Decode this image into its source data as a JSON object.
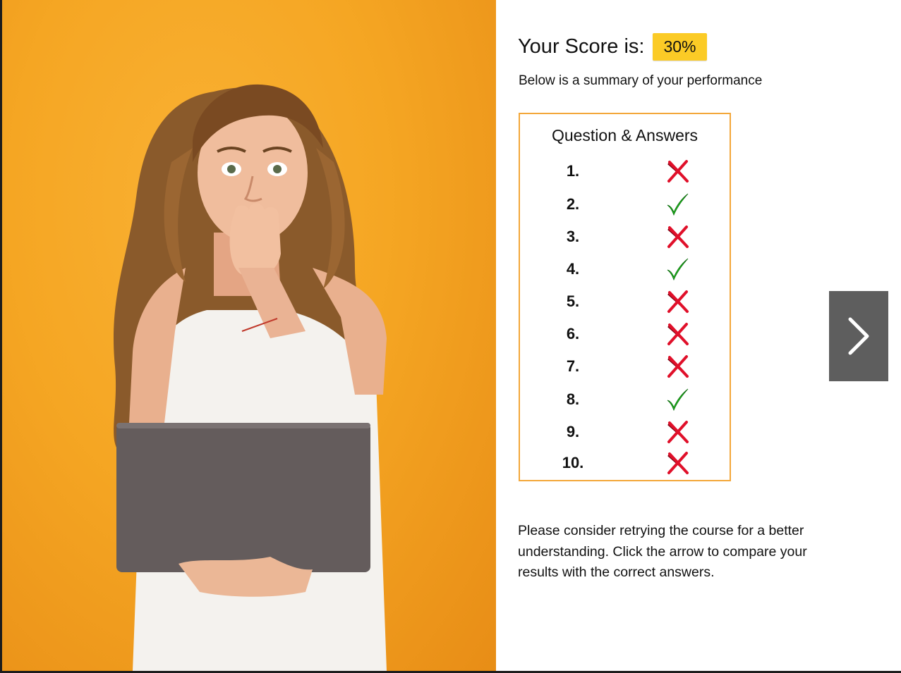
{
  "score": {
    "label": "Your Score is:",
    "value": "30%",
    "badge_color": "#fbcb26"
  },
  "summary_text": "Below is a summary of your performance",
  "qa_panel": {
    "title": "Question & Answers",
    "border_color": "#f3a73a",
    "rows": [
      {
        "num": "1.",
        "result": "incorrect"
      },
      {
        "num": "2.",
        "result": "correct"
      },
      {
        "num": "3.",
        "result": "incorrect"
      },
      {
        "num": "4.",
        "result": "correct"
      },
      {
        "num": "5.",
        "result": "incorrect"
      },
      {
        "num": "6.",
        "result": "incorrect"
      },
      {
        "num": "7.",
        "result": "incorrect"
      },
      {
        "num": "8.",
        "result": "correct"
      },
      {
        "num": "9.",
        "result": "incorrect"
      },
      {
        "num": "10.",
        "result": "incorrect"
      }
    ]
  },
  "retry_text": "Please consider retrying the course for a better understanding. Click the arrow to compare your results with the correct answers.",
  "next_button": {
    "icon": "chevron-right-icon",
    "bg_color": "#5e5e5e"
  },
  "colors": {
    "correct": "#22cc22",
    "incorrect": "#e0102a",
    "photo_background": "#f5a623"
  }
}
